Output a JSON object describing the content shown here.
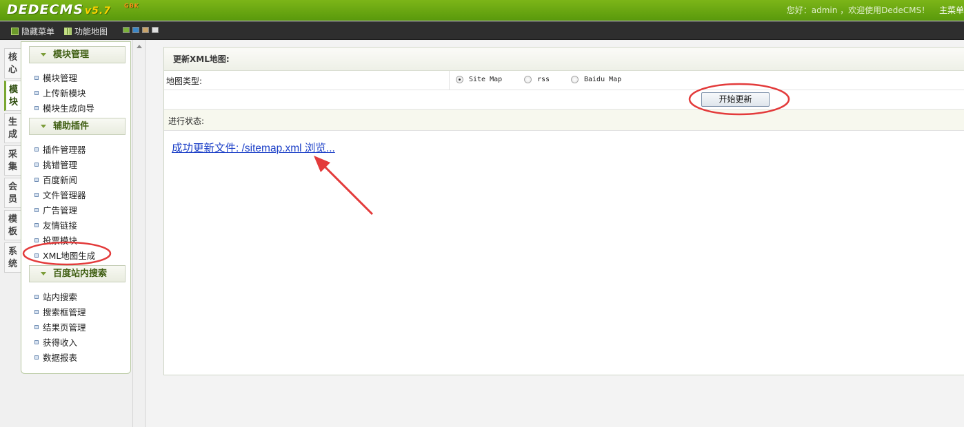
{
  "header": {
    "logo_text": "DEDECMS",
    "logo_version": "v5.7",
    "logo_badge": "GBK",
    "welcome": "您好：admin ，欢迎使用DedeCMS！",
    "main_menu": "主菜单"
  },
  "toolbar": {
    "hide_menu": "隐藏菜单",
    "function_map": "功能地图",
    "skin_colors": [
      "#7bb23a",
      "#3b86c6",
      "#c8a36a",
      "#e0e0e0"
    ]
  },
  "vtabs": [
    "核心",
    "模块",
    "生成",
    "采集",
    "会员",
    "模板",
    "系统"
  ],
  "vtab_active": "模块",
  "sidebar": {
    "groups": [
      {
        "title": "模块管理",
        "items": [
          "模块管理",
          "上传新模块",
          "模块生成向导"
        ]
      },
      {
        "title": "辅助插件",
        "items": [
          "插件管理器",
          "挑错管理",
          "百度新闻",
          "文件管理器",
          "广告管理",
          "友情链接",
          "投票模块",
          "XML地图生成"
        ]
      },
      {
        "title": "百度站内搜索",
        "items": [
          "站内搜索",
          "搜索框管理",
          "结果页管理",
          "获得收入",
          "数据报表"
        ]
      }
    ]
  },
  "main": {
    "title": "更新XML地图:",
    "map_type_label": "地图类型:",
    "map_types": [
      {
        "label": "Site Map",
        "checked": true
      },
      {
        "label": "rss",
        "checked": false
      },
      {
        "label": "Baidu Map",
        "checked": false
      }
    ],
    "start_button": "开始更新",
    "status_label": "进行状态:",
    "result_link": "成功更新文件: /sitemap.xml 浏览..."
  },
  "annotations": {
    "color": "#e33b3b"
  }
}
